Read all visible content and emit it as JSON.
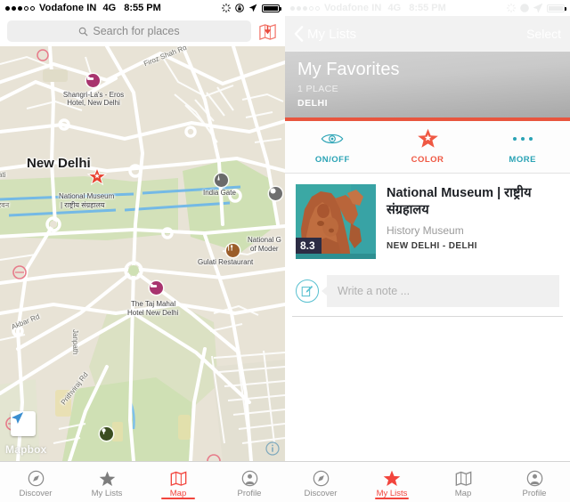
{
  "status_bar": {
    "carrier": "Vodafone IN",
    "network": "4G",
    "time": "8:55 PM",
    "signal_dots_filled": 3,
    "signal_dots_total": 5,
    "icons": [
      "spinner-icon",
      "lock-rotation-icon",
      "location-arrow-icon",
      "battery-icon"
    ]
  },
  "left_screen": {
    "search": {
      "placeholder": "Search for places",
      "icon": "search-icon",
      "map_toggle_icon": "map-pin-book-icon"
    },
    "map": {
      "attribution": "Mapbox",
      "locate_icon": "locate-arrow-icon",
      "info_icon": "info-icon",
      "city_label": "New Delhi",
      "labels": [
        {
          "text": "Shangri-La's - Eros Hotel, New Delhi",
          "kind": "poi"
        },
        {
          "text": "National Museum | राष्ट्रीय संग्रहालय",
          "kind": "poi-selected"
        },
        {
          "text": "India Gate",
          "kind": "poi"
        },
        {
          "text": "Gulati Restaurant",
          "kind": "poi"
        },
        {
          "text": "National Gallery of Moder",
          "kind": "poi"
        },
        {
          "text": "The Taj Mahal Hotel New Delhi",
          "kind": "poi"
        },
        {
          "text": "Firoz Shah Rd",
          "kind": "road"
        },
        {
          "text": "Akbar Rd",
          "kind": "road"
        },
        {
          "text": "Janpath",
          "kind": "road"
        },
        {
          "text": "Prithviraj Rd",
          "kind": "road"
        }
      ],
      "edge_labels": [
        "ati",
        "रवन"
      ],
      "poi_labels": {
        "hotel_shangri": "Shangri-La's -\nEros Hotel, New\nDelhi",
        "national_museum_l1": "National Museum",
        "national_museum_l2": "| राष्ट्रीय संग्रहालय",
        "india_gate": "India Gate",
        "gulati": "Gulati Restaurant",
        "ngma_l1": "National G",
        "ngma_l2": "of Moder",
        "taj_l1": "The Taj Mahal",
        "taj_l2": "Hotel New Delhi",
        "firoz": "Firoz Shah Rd",
        "akbar": "Akbar Rd",
        "janpath": "Janpath",
        "prithviraj": "Prithviraj Rd",
        "edge1": "ati",
        "edge2": "रवन"
      }
    },
    "tabs": [
      {
        "label": "Discover",
        "icon": "compass-icon",
        "active": false
      },
      {
        "label": "My Lists",
        "icon": "star-icon",
        "active": false
      },
      {
        "label": "Map",
        "icon": "map-icon",
        "active": true
      },
      {
        "label": "Profile",
        "icon": "person-circle-icon",
        "active": false
      }
    ]
  },
  "right_screen": {
    "navbar": {
      "back_label": "My Lists",
      "back_icon": "chevron-left-icon",
      "select_label": "Select"
    },
    "hero": {
      "title": "My Favorites",
      "count": "1 PLACE",
      "city": "DELHI"
    },
    "actions": [
      {
        "label": "ON/OFF",
        "icon": "eye-icon",
        "color": "#2aa3b5"
      },
      {
        "label": "COLOR",
        "icon": "star-badge-icon",
        "color": "#ef5843"
      },
      {
        "label": "MORE",
        "icon": "ellipsis-icon",
        "color": "#2aa3b5"
      }
    ],
    "place": {
      "rating": "8.3",
      "title": "National Museum | राष्ट्रीय संग्रहालय",
      "category": "History Museum",
      "location": "NEW DELHI - DELHI",
      "thumbnail_alt": "terracotta-sculpture-thumbnail"
    },
    "note": {
      "placeholder": "Write a note ...",
      "icon": "edit-note-icon"
    },
    "tabs": [
      {
        "label": "Discover",
        "icon": "compass-icon",
        "active": false
      },
      {
        "label": "My Lists",
        "icon": "star-icon",
        "active": true
      },
      {
        "label": "Map",
        "icon": "map-icon",
        "active": false
      },
      {
        "label": "Profile",
        "icon": "person-circle-icon",
        "active": false
      }
    ]
  },
  "colors": {
    "accent_red": "#f2453d",
    "hero_border": "#e8553e",
    "teal": "#2aa3b5",
    "rating_bg": "#2c2c44"
  }
}
